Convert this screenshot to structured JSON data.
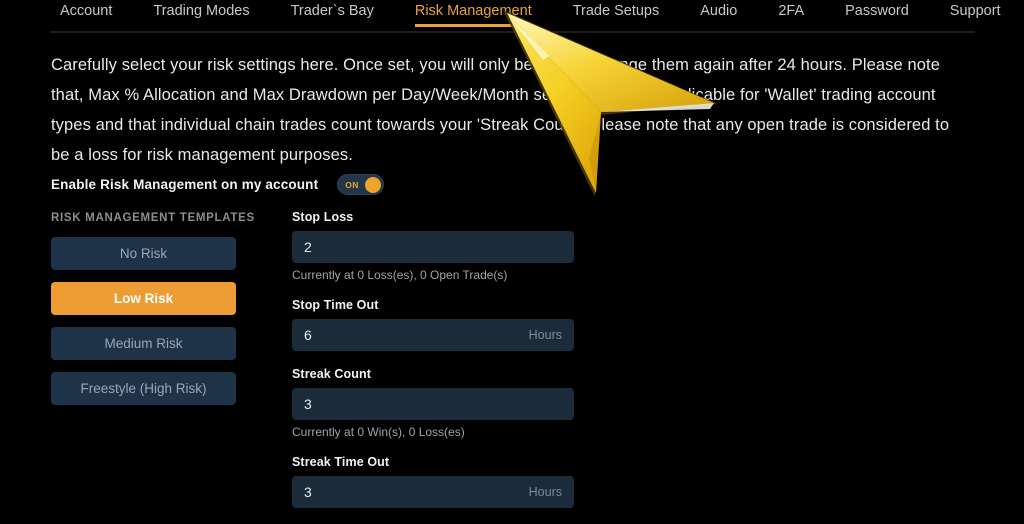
{
  "nav": {
    "tabs": [
      {
        "label": "Account",
        "active": false
      },
      {
        "label": "Trading Modes",
        "active": false
      },
      {
        "label": "Trader`s Bay",
        "active": false
      },
      {
        "label": "Risk Management",
        "active": true
      },
      {
        "label": "Trade Setups",
        "active": false
      },
      {
        "label": "Audio",
        "active": false
      },
      {
        "label": "2FA",
        "active": false
      },
      {
        "label": "Password",
        "active": false
      },
      {
        "label": "Support",
        "active": false
      }
    ]
  },
  "description": {
    "text": "Carefully select your risk settings here. Once set, you will only be able to change them again after 24 hours. Please note that, Max % Allocation and Max Drawdown per Day/Week/Month settings are only applicable for 'Wallet' trading account types and that individual chain trades count towards your 'Streak Count'. Please note that any open trade is considered to be a loss for risk management purposes."
  },
  "enable": {
    "label": "Enable Risk Management on my account",
    "toggle_state": "ON"
  },
  "templates": {
    "heading": "RISK MANAGEMENT TEMPLATES",
    "items": [
      {
        "label": "No Risk",
        "selected": false
      },
      {
        "label": "Low Risk",
        "selected": true
      },
      {
        "label": "Medium Risk",
        "selected": false
      },
      {
        "label": "Freestyle (High Risk)",
        "selected": false
      }
    ]
  },
  "fields": [
    {
      "label": "Stop Loss",
      "value": "2",
      "suffix": "",
      "hint": "Currently at 0 Loss(es), 0 Open Trade(s)"
    },
    {
      "label": "Stop Time Out",
      "value": "6",
      "suffix": "Hours",
      "hint": ""
    },
    {
      "label": "Streak Count",
      "value": "3",
      "suffix": "",
      "hint": "Currently at 0 Win(s), 0 Loss(es)"
    },
    {
      "label": "Streak Time Out",
      "value": "3",
      "suffix": "Hours",
      "hint": ""
    }
  ],
  "colors": {
    "accent": "#e8a33d",
    "selected_template": "#ed9d33",
    "panel": "#1e3348",
    "input": "#1b2b3a",
    "background": "#000000",
    "cursor": "#f2d12a"
  },
  "cursor": {
    "icon": "arrow-pointer-cursor"
  }
}
